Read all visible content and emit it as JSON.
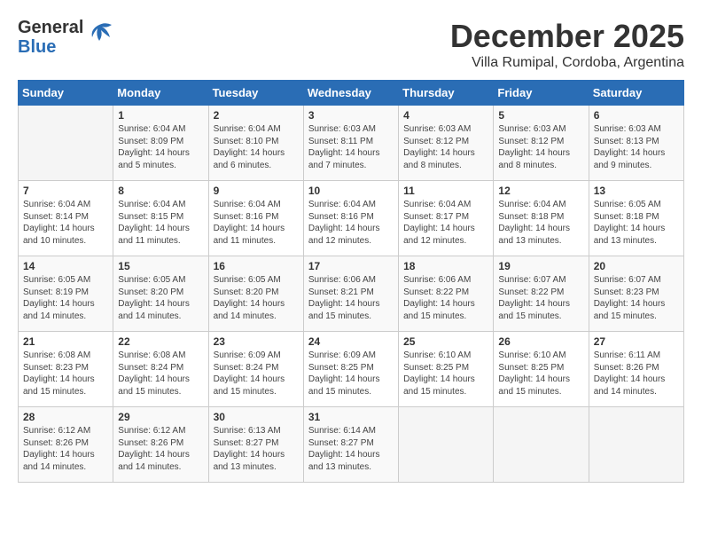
{
  "logo": {
    "line1": "General",
    "line2": "Blue"
  },
  "title": "December 2025",
  "subtitle": "Villa Rumipal, Cordoba, Argentina",
  "weekdays": [
    "Sunday",
    "Monday",
    "Tuesday",
    "Wednesday",
    "Thursday",
    "Friday",
    "Saturday"
  ],
  "weeks": [
    [
      {
        "day": "",
        "sunrise": "",
        "sunset": "",
        "daylight": ""
      },
      {
        "day": "1",
        "sunrise": "Sunrise: 6:04 AM",
        "sunset": "Sunset: 8:09 PM",
        "daylight": "Daylight: 14 hours and 5 minutes."
      },
      {
        "day": "2",
        "sunrise": "Sunrise: 6:04 AM",
        "sunset": "Sunset: 8:10 PM",
        "daylight": "Daylight: 14 hours and 6 minutes."
      },
      {
        "day": "3",
        "sunrise": "Sunrise: 6:03 AM",
        "sunset": "Sunset: 8:11 PM",
        "daylight": "Daylight: 14 hours and 7 minutes."
      },
      {
        "day": "4",
        "sunrise": "Sunrise: 6:03 AM",
        "sunset": "Sunset: 8:12 PM",
        "daylight": "Daylight: 14 hours and 8 minutes."
      },
      {
        "day": "5",
        "sunrise": "Sunrise: 6:03 AM",
        "sunset": "Sunset: 8:12 PM",
        "daylight": "Daylight: 14 hours and 8 minutes."
      },
      {
        "day": "6",
        "sunrise": "Sunrise: 6:03 AM",
        "sunset": "Sunset: 8:13 PM",
        "daylight": "Daylight: 14 hours and 9 minutes."
      }
    ],
    [
      {
        "day": "7",
        "sunrise": "Sunrise: 6:04 AM",
        "sunset": "Sunset: 8:14 PM",
        "daylight": "Daylight: 14 hours and 10 minutes."
      },
      {
        "day": "8",
        "sunrise": "Sunrise: 6:04 AM",
        "sunset": "Sunset: 8:15 PM",
        "daylight": "Daylight: 14 hours and 11 minutes."
      },
      {
        "day": "9",
        "sunrise": "Sunrise: 6:04 AM",
        "sunset": "Sunset: 8:16 PM",
        "daylight": "Daylight: 14 hours and 11 minutes."
      },
      {
        "day": "10",
        "sunrise": "Sunrise: 6:04 AM",
        "sunset": "Sunset: 8:16 PM",
        "daylight": "Daylight: 14 hours and 12 minutes."
      },
      {
        "day": "11",
        "sunrise": "Sunrise: 6:04 AM",
        "sunset": "Sunset: 8:17 PM",
        "daylight": "Daylight: 14 hours and 12 minutes."
      },
      {
        "day": "12",
        "sunrise": "Sunrise: 6:04 AM",
        "sunset": "Sunset: 8:18 PM",
        "daylight": "Daylight: 14 hours and 13 minutes."
      },
      {
        "day": "13",
        "sunrise": "Sunrise: 6:05 AM",
        "sunset": "Sunset: 8:18 PM",
        "daylight": "Daylight: 14 hours and 13 minutes."
      }
    ],
    [
      {
        "day": "14",
        "sunrise": "Sunrise: 6:05 AM",
        "sunset": "Sunset: 8:19 PM",
        "daylight": "Daylight: 14 hours and 14 minutes."
      },
      {
        "day": "15",
        "sunrise": "Sunrise: 6:05 AM",
        "sunset": "Sunset: 8:20 PM",
        "daylight": "Daylight: 14 hours and 14 minutes."
      },
      {
        "day": "16",
        "sunrise": "Sunrise: 6:05 AM",
        "sunset": "Sunset: 8:20 PM",
        "daylight": "Daylight: 14 hours and 14 minutes."
      },
      {
        "day": "17",
        "sunrise": "Sunrise: 6:06 AM",
        "sunset": "Sunset: 8:21 PM",
        "daylight": "Daylight: 14 hours and 15 minutes."
      },
      {
        "day": "18",
        "sunrise": "Sunrise: 6:06 AM",
        "sunset": "Sunset: 8:22 PM",
        "daylight": "Daylight: 14 hours and 15 minutes."
      },
      {
        "day": "19",
        "sunrise": "Sunrise: 6:07 AM",
        "sunset": "Sunset: 8:22 PM",
        "daylight": "Daylight: 14 hours and 15 minutes."
      },
      {
        "day": "20",
        "sunrise": "Sunrise: 6:07 AM",
        "sunset": "Sunset: 8:23 PM",
        "daylight": "Daylight: 14 hours and 15 minutes."
      }
    ],
    [
      {
        "day": "21",
        "sunrise": "Sunrise: 6:08 AM",
        "sunset": "Sunset: 8:23 PM",
        "daylight": "Daylight: 14 hours and 15 minutes."
      },
      {
        "day": "22",
        "sunrise": "Sunrise: 6:08 AM",
        "sunset": "Sunset: 8:24 PM",
        "daylight": "Daylight: 14 hours and 15 minutes."
      },
      {
        "day": "23",
        "sunrise": "Sunrise: 6:09 AM",
        "sunset": "Sunset: 8:24 PM",
        "daylight": "Daylight: 14 hours and 15 minutes."
      },
      {
        "day": "24",
        "sunrise": "Sunrise: 6:09 AM",
        "sunset": "Sunset: 8:25 PM",
        "daylight": "Daylight: 14 hours and 15 minutes."
      },
      {
        "day": "25",
        "sunrise": "Sunrise: 6:10 AM",
        "sunset": "Sunset: 8:25 PM",
        "daylight": "Daylight: 14 hours and 15 minutes."
      },
      {
        "day": "26",
        "sunrise": "Sunrise: 6:10 AM",
        "sunset": "Sunset: 8:25 PM",
        "daylight": "Daylight: 14 hours and 15 minutes."
      },
      {
        "day": "27",
        "sunrise": "Sunrise: 6:11 AM",
        "sunset": "Sunset: 8:26 PM",
        "daylight": "Daylight: 14 hours and 14 minutes."
      }
    ],
    [
      {
        "day": "28",
        "sunrise": "Sunrise: 6:12 AM",
        "sunset": "Sunset: 8:26 PM",
        "daylight": "Daylight: 14 hours and 14 minutes."
      },
      {
        "day": "29",
        "sunrise": "Sunrise: 6:12 AM",
        "sunset": "Sunset: 8:26 PM",
        "daylight": "Daylight: 14 hours and 14 minutes."
      },
      {
        "day": "30",
        "sunrise": "Sunrise: 6:13 AM",
        "sunset": "Sunset: 8:27 PM",
        "daylight": "Daylight: 14 hours and 13 minutes."
      },
      {
        "day": "31",
        "sunrise": "Sunrise: 6:14 AM",
        "sunset": "Sunset: 8:27 PM",
        "daylight": "Daylight: 14 hours and 13 minutes."
      },
      {
        "day": "",
        "sunrise": "",
        "sunset": "",
        "daylight": ""
      },
      {
        "day": "",
        "sunrise": "",
        "sunset": "",
        "daylight": ""
      },
      {
        "day": "",
        "sunrise": "",
        "sunset": "",
        "daylight": ""
      }
    ]
  ]
}
